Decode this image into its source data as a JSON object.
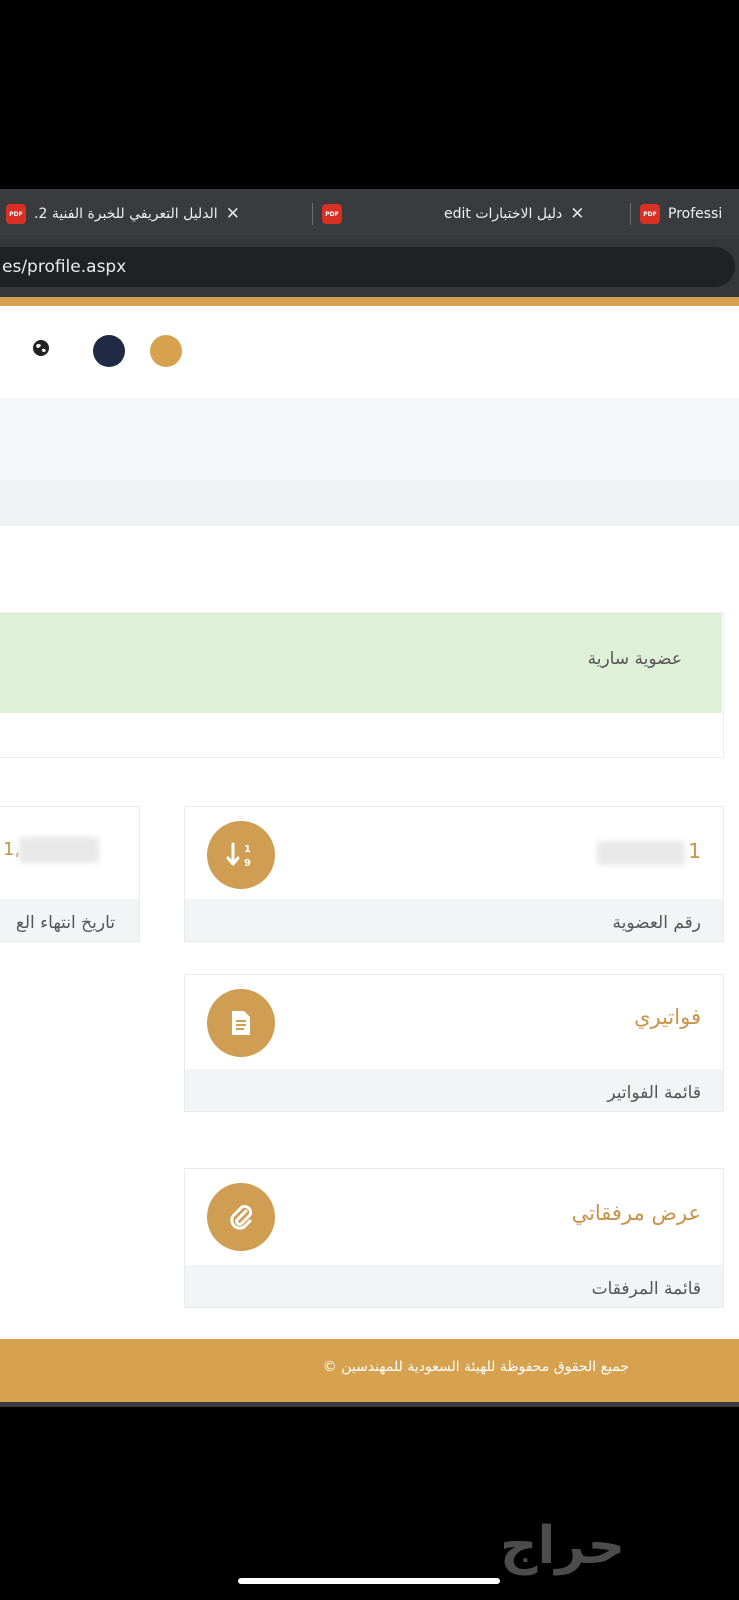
{
  "browser": {
    "tabs": [
      {
        "title": "الدليل التعريفي للخبرة الفنية 2.",
        "icon": "pdf-icon"
      },
      {
        "title": "دليل الاختبارات edit",
        "icon": "pdf-icon"
      },
      {
        "title": "Professi",
        "icon": "pdf-icon"
      }
    ],
    "pdf_badge": "PDF",
    "close_glyph": "✕",
    "url": "es/profile.aspx"
  },
  "colors": {
    "accent": "#d6a24f",
    "navy": "#1f2a44",
    "success_bg": "#dff0d8"
  },
  "status": {
    "label": "عضوية سارية"
  },
  "cards": {
    "membership_number": {
      "value_visible": "1",
      "label": "رقم العضوية",
      "icon": "sort-numeric-icon"
    },
    "expiry": {
      "value_visible": "1,",
      "label": "تاريخ انتهاء الع",
      "icon": "calendar-icon"
    },
    "invoices": {
      "title": "فواتيري",
      "label": "قائمة الفواتير",
      "icon": "document-icon"
    },
    "attachments": {
      "title": "عرض مرفقاتي",
      "label": "قائمة المرفقات",
      "icon": "paperclip-icon"
    }
  },
  "footer": {
    "text": "جميع الحقوق محفوظة للهيئة السعودية للمهندسين ©"
  },
  "watermark": {
    "text": "حراج"
  }
}
